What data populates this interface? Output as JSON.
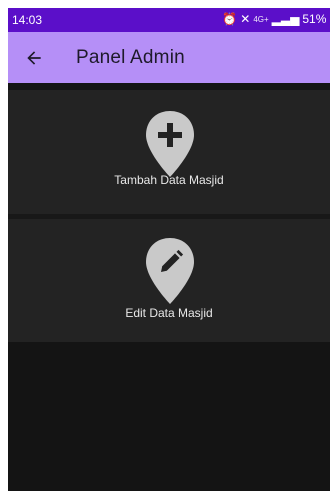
{
  "status_bar": {
    "time": "14:03",
    "network": "4G+",
    "battery": "51%"
  },
  "app_bar": {
    "title": "Panel Admin"
  },
  "menu": [
    {
      "label": "Tambah Data Masjid",
      "icon": "add-location-icon"
    },
    {
      "label": "Edit Data Masjid",
      "icon": "edit-location-icon"
    }
  ],
  "colors": {
    "status_bar": "#5b0fc9",
    "app_bar": "#b58ff7",
    "background": "#141414",
    "card": "#232323",
    "pin": "#c9c9c9"
  }
}
